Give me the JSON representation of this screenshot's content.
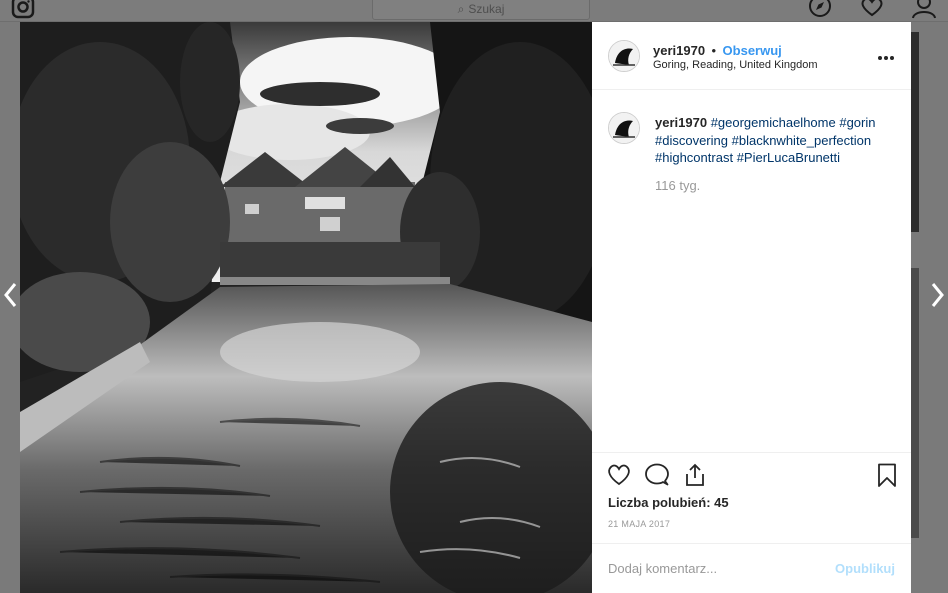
{
  "nav": {
    "search_placeholder": "Szukaj",
    "logo_icon": "instagram-icon",
    "icons": [
      "compass-icon",
      "heart-icon",
      "profile-icon"
    ]
  },
  "post": {
    "username": "yeri1970",
    "follow_label": "Obserwuj",
    "separator": "•",
    "location": "Goring, Reading, United Kingdom",
    "caption": {
      "username": "yeri1970",
      "tags": [
        "#georgemichaelhome",
        "#gorin",
        "#discovering",
        "#blacknwhite_perfection",
        "#highcontrast",
        "#PierLucaBrunetti"
      ]
    },
    "time_ago": "116 tyg.",
    "likes_label": "Liczba polubień: 45",
    "date": "21 MAJA 2017",
    "comment_placeholder": "Dodaj komentarz...",
    "publish_label": "Opublikuj"
  },
  "colors": {
    "accent": "#3897f0",
    "hashtag": "#003569",
    "muted": "#999999",
    "publish_disabled": "#b2dffc",
    "overlay": "#7a7a7a"
  }
}
